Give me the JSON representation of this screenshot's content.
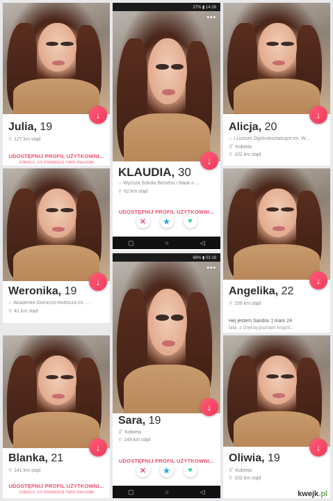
{
  "colors": {
    "accent": "#f04a6a",
    "like_fab": "#f03a5d",
    "super": "#28a6e8",
    "like": "#2fd3b0",
    "background": "#e9e9ec"
  },
  "share_text": "UDOSTĘPNIJ PROFIL UŻYTKOWNI...",
  "share_text_full": "UDOSTĘPNIJ PROFIL UŻYTKOWNIKA",
  "share_sub_text": "ZOBACZ, CO POWIEDZĄ TWOI ZNAJOMI",
  "profiles": {
    "julia": {
      "name": "Julia,",
      "age": "19",
      "distance": "127 km stąd"
    },
    "klaudia": {
      "name": "KLAUDIA,",
      "age": "30",
      "school": "Wyższa Szkoła Biznesu i Nauk o ...",
      "distance": "62 km stąd"
    },
    "alicja": {
      "name": "Alicja,",
      "age": "20",
      "school": "I Liceum Ogólnokształcące im. W...",
      "gender": "Kobieta",
      "distance": "102 km stąd"
    },
    "weronika": {
      "name": "Weronika,",
      "age": "19",
      "school": "Akademia Górniczo-Hutnicza im. ...",
      "distance": "41 km stąd"
    },
    "angelika": {
      "name": "Angelika,",
      "age": "22",
      "distance": "156 km stąd",
      "bio_line1": "Hej jestem Sandra :) mam 24",
      "bio_line2": "lata, z chęcią poznam kogoś..."
    },
    "sara": {
      "name": "Sara,",
      "age": "19",
      "gender": "Kobieta",
      "distance": "149 km stąd"
    },
    "blanka": {
      "name": "Blanka,",
      "age": "21",
      "distance": "141 km stąd"
    },
    "oliwia": {
      "name": "Oliwia,",
      "age": "19",
      "gender": "Kobieta",
      "distance": "102 km stąd"
    }
  },
  "status_top": "27% ▮ 14:26",
  "status_mid": "68% ▮ 03:18",
  "actions": {
    "nope": "✕",
    "super": "★",
    "like": "♥"
  },
  "nav": {
    "square": "▢",
    "circle": "○",
    "back": "◁"
  },
  "icons": {
    "like_fab": "↓",
    "more": "•••",
    "school": "⌂",
    "pin": "⚲",
    "gender": "⚥"
  },
  "watermark": {
    "brand": "kwejk",
    "suffix": ".pl"
  }
}
